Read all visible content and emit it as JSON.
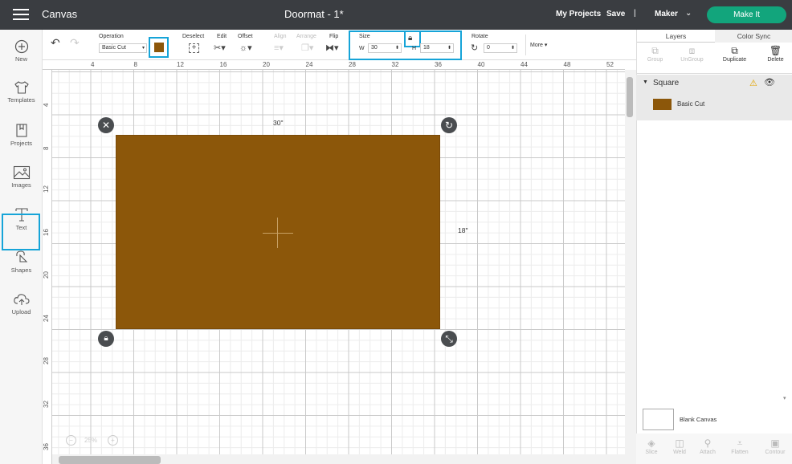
{
  "header": {
    "app_title": "Canvas",
    "doc_title": "Doormat - 1*",
    "my_projects": "My Projects",
    "save": "Save",
    "separator": "|",
    "machine": "Maker",
    "make_it": "Make It"
  },
  "sidebar": {
    "items": [
      {
        "label": "New",
        "icon": "plus-circle-icon"
      },
      {
        "label": "Templates",
        "icon": "tshirt-icon"
      },
      {
        "label": "Projects",
        "icon": "projects-icon"
      },
      {
        "label": "Images",
        "icon": "image-icon"
      },
      {
        "label": "Text",
        "icon": "text-icon"
      },
      {
        "label": "Shapes",
        "icon": "shapes-icon"
      },
      {
        "label": "Upload",
        "icon": "upload-cloud-icon"
      }
    ]
  },
  "toolbar": {
    "operation_label": "Operation",
    "operation_value": "Basic Cut",
    "deselect_label": "Deselect",
    "edit_label": "Edit",
    "offset_label": "Offset",
    "align_label": "Align",
    "arrange_label": "Arrange",
    "flip_label": "Flip",
    "size_label": "Size",
    "w_label": "W",
    "w_value": "30",
    "h_label": "H",
    "h_value": "18",
    "rotate_label": "Rotate",
    "rotate_value": "0",
    "more_label": "More",
    "accent_color": "#16a4d8",
    "shape_color": "#8c570a"
  },
  "ruler": {
    "top": [
      "4",
      "8",
      "12",
      "16",
      "20",
      "24",
      "28",
      "32",
      "36",
      "40",
      "44",
      "48",
      "52"
    ],
    "left": [
      "4",
      "8",
      "12",
      "16",
      "20",
      "24",
      "28",
      "32",
      "36"
    ]
  },
  "canvas": {
    "width_label": "30\"",
    "height_label": "18\"",
    "zoom": "25%"
  },
  "panel": {
    "tabs": [
      "Layers",
      "Color Sync"
    ],
    "buttons": [
      "Group",
      "UnGroup",
      "Duplicate",
      "Delete"
    ],
    "layer_group": "Square",
    "layer_item": "Basic Cut",
    "blank_canvas": "Blank Canvas",
    "bottom_tools": [
      "Slice",
      "Weld",
      "Attach",
      "Flatten",
      "Contour"
    ]
  }
}
